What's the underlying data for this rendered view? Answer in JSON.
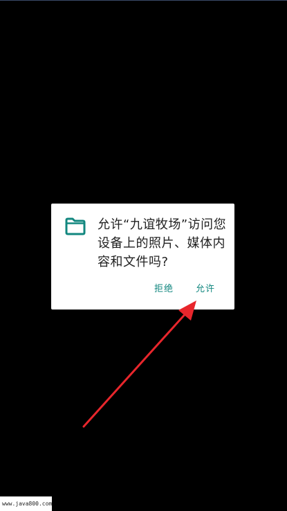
{
  "dialog": {
    "icon": "folder-icon",
    "message": "允许“九谊牧场”访问您设备上的照片、媒体内容和文件吗?",
    "deny_label": "拒绝",
    "allow_label": "允许"
  },
  "annotation": {
    "arrow_color": "#e8262c",
    "points_to": "allow-button"
  },
  "watermark": {
    "text": "www.java800.com"
  },
  "colors": {
    "background": "#000000",
    "dialog_background": "#ffffff",
    "accent": "#12877f",
    "message_text": "#212121"
  }
}
